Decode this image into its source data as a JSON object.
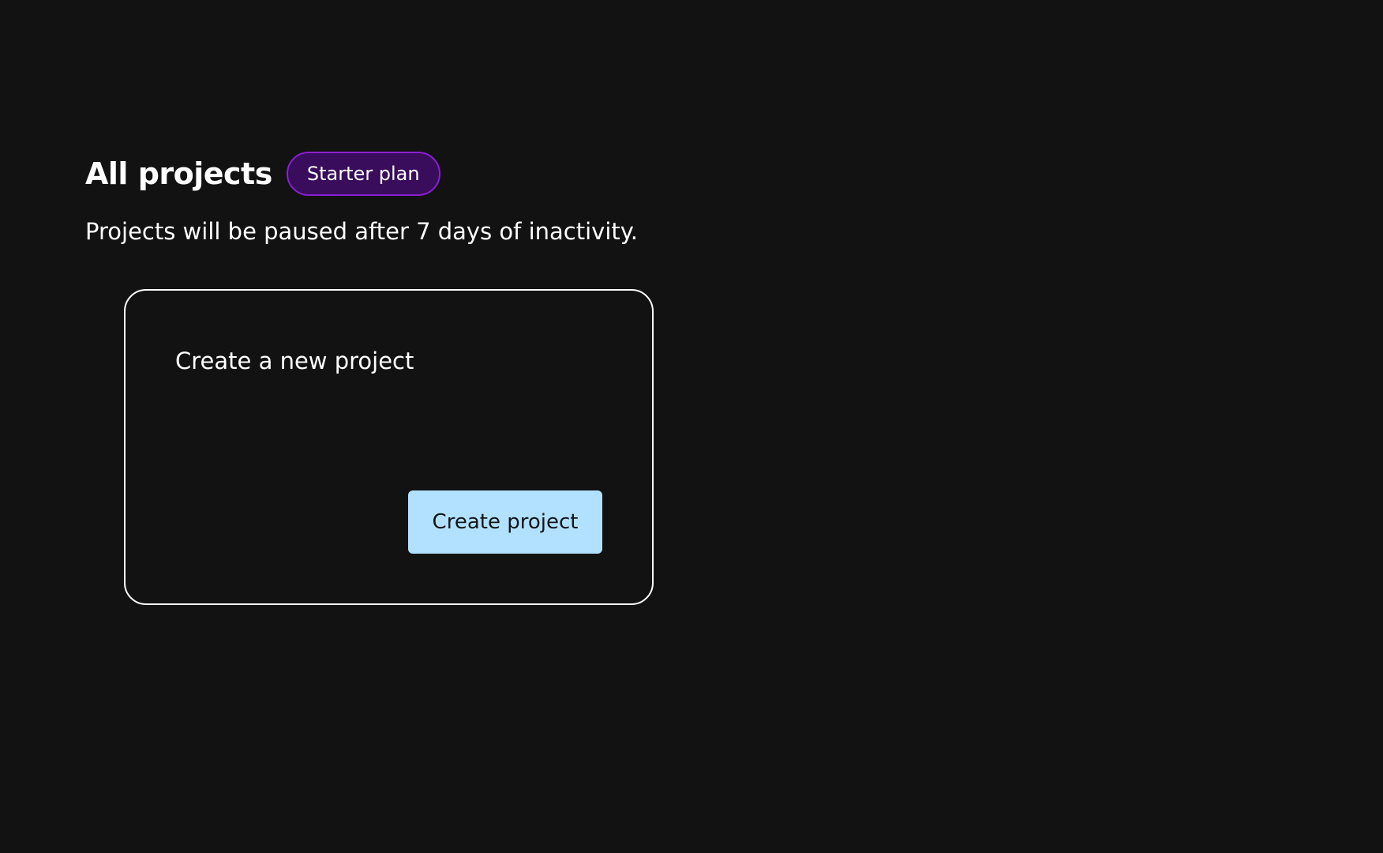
{
  "header": {
    "title": "All projects",
    "plan_badge": "Starter plan"
  },
  "subtitle": "Projects will be paused after 7 days of inactivity.",
  "new_project_card": {
    "title": "Create a new project",
    "button_label": "Create project"
  },
  "colors": {
    "background": "#121213",
    "badge_border": "#8a1fd1",
    "badge_fill": "#3a0c5c",
    "button_fill": "#b1e1fe",
    "button_text": "#121619"
  }
}
